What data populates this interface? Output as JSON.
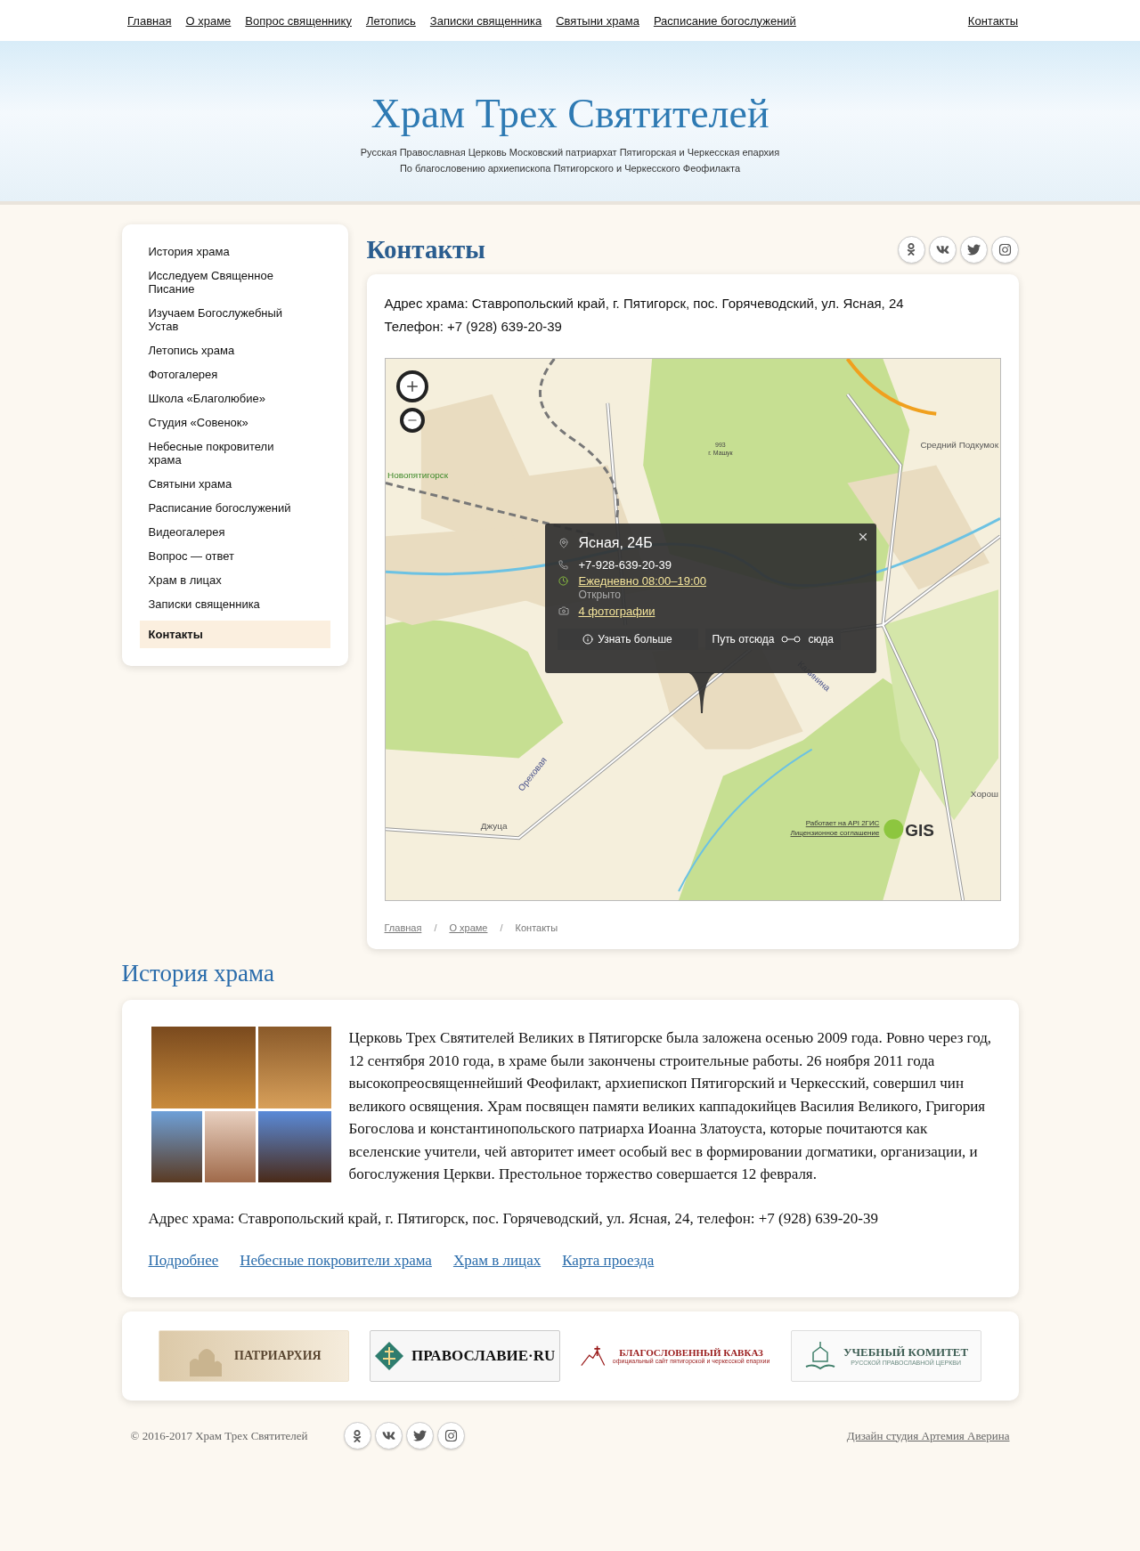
{
  "top_nav": {
    "links": [
      "Главная",
      "О храме",
      "Вопрос священнику",
      "Летопись",
      "Записки священника",
      "Святыни храма",
      "Расписание богослужений"
    ],
    "contacts_link": "Контакты"
  },
  "banner": {
    "title": "Храм Трех Святителей",
    "subtitle_lines": [
      "Русская Православная Церковь Московский патриархат Пятигорская и Черкесская епархия",
      "По благословению архиепископа Пятигорского и Черкесского Феофилакта"
    ]
  },
  "sidebar": {
    "items": [
      {
        "label": "История храма",
        "selected": false
      },
      {
        "label": "Исследуем Священное Писание",
        "selected": false
      },
      {
        "label": "Изучаем Богослужебный Устав",
        "selected": false
      },
      {
        "label": "Летопись храма",
        "selected": false
      },
      {
        "label": "Фотогалерея",
        "selected": false
      },
      {
        "label": "Школа «Благолюбие»",
        "selected": false
      },
      {
        "label": "Студия «Совенок»",
        "selected": false
      },
      {
        "label": "Небесные покровители храма",
        "selected": false
      },
      {
        "label": "Святыни храма",
        "selected": false
      },
      {
        "label": "Расписание богослужений",
        "selected": false
      },
      {
        "label": "Видеогалерея",
        "selected": false
      },
      {
        "label": "Вопрос — ответ",
        "selected": false
      },
      {
        "label": "Храм в лицах",
        "selected": false
      },
      {
        "label": "Записки священника",
        "selected": false
      },
      {
        "label": "Контакты",
        "selected": true
      }
    ]
  },
  "page": {
    "title": "Контакты",
    "social_links": [
      {
        "kind": "ok"
      },
      {
        "kind": "vk"
      },
      {
        "kind": "twitter"
      },
      {
        "kind": "instagram"
      }
    ],
    "contact_lines": [
      "Адрес храма: Ставропольский край, г. Пятигорск, пос. Горячеводский, ул. Ясная, 24",
      "Телефон: +7 (928) 639-20-39"
    ],
    "map": {
      "labels": [
        {
          "text": "993",
          "kind": "small"
        },
        {
          "text": "г. Машук",
          "kind": "small"
        },
        {
          "text": "Средний Подкумок",
          "kind": "place"
        },
        {
          "text": "Новопятигорск",
          "kind": "green"
        },
        {
          "text": "Калинина",
          "kind": "street"
        },
        {
          "text": "Ореховая",
          "kind": "street"
        },
        {
          "text": "Хорош",
          "kind": "place"
        },
        {
          "text": "Джуца",
          "kind": "place"
        }
      ],
      "attribution": [
        "Работает на API 2ГИС",
        "Лицензионное соглашение"
      ],
      "logo": "GIS",
      "popup": {
        "title": "Ясная, 24Б",
        "phone": "+7-928-639-20-39",
        "hours": "Ежедневно 08:00–19:00",
        "status": "Открыто",
        "photos": "4 фотографии",
        "more_button": "Узнать больше",
        "route_from": "Путь отсюда",
        "route_to": "сюда"
      }
    },
    "breadcrumb_separator": "/",
    "breadcrumbs": [
      {
        "label": "Главная",
        "link": true
      },
      {
        "label": "О храме",
        "link": true
      },
      {
        "label": "Контакты",
        "link": false
      }
    ]
  },
  "history": {
    "title": "История храма",
    "paragraph": "Церковь Трех Святителей Великих в Пятигорске была заложена осенью 2009 года. Ровно через год, 12 сентября 2010 года, в храме были закончены строительные работы. 26 ноября 2011 года высокопреосвященнейший Феофилакт, архиепископ Пятигорский и Черкесский, совершил чин великого освящения. Храм посвящен памяти великих каппадокийцев Василия Великого, Григория\nБогослова и константинопольского патриарха Иоанна Златоуста, которые почитаются как вселенские учители, чей авторитет имеет особый вес в формировании догматики, организации, и богослужения Церкви. Престольное торжество совершается 12 февраля.",
    "address": "Адрес храма: Ставропольский край, г. Пятигорск, пос. Горячеводский, ул. Ясная, 24, телефон: +7 (928) 639-20-39",
    "links": [
      "Подробнее",
      "Небесные покровители храма",
      "Храм в лицах",
      "Карта проезда"
    ]
  },
  "partners": [
    {
      "kind": "patriarchy",
      "lines": [
        "ПАТРИАРХИЯ"
      ]
    },
    {
      "kind": "pravoslavie",
      "lines": [
        "ПРАВОСЛАВИЕ·RU"
      ]
    },
    {
      "kind": "caucasus",
      "lines": [
        "БЛАГОСЛОВЕННЫЙ КАВКАЗ",
        "официальный сайт пятигорской и черкесской епархии"
      ]
    },
    {
      "kind": "committee",
      "lines": [
        "УЧЕБНЫЙ КОМИТЕТ",
        "РУССКОЙ ПРАВОСЛАВНОЙ ЦЕРКВИ"
      ]
    }
  ],
  "footer": {
    "copyright": "© 2016-2017 Храм Трех Святителей",
    "social_links": [
      {
        "kind": "ok"
      },
      {
        "kind": "vk"
      },
      {
        "kind": "twitter"
      },
      {
        "kind": "instagram"
      }
    ],
    "credit": "Дизайн студия Артемия Аверина"
  }
}
